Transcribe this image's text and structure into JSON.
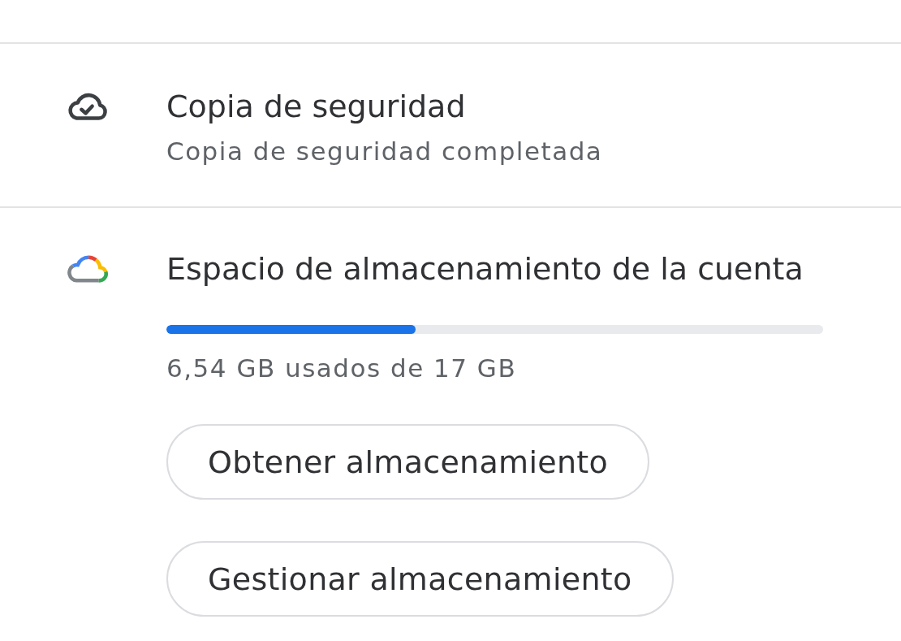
{
  "sections": [
    {
      "kind": "backup",
      "title": "Copia de seguridad",
      "subtitle": "Copia de seguridad completada"
    },
    {
      "kind": "storage",
      "title": "Espacio de almacenamiento de la cuenta",
      "level": 0.38,
      "usage": "6,54 GB usados de 17 GB",
      "buttons": [
        "Obtener almacenamiento",
        "Gestionar almacenamiento"
      ]
    }
  ]
}
